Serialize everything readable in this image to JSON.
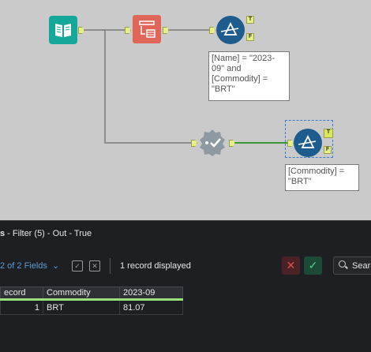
{
  "workflow": {
    "filter1": {
      "true_anchor": "T",
      "false_anchor": "F",
      "annotation": [
        "[Name] = \"2023-",
        "09\" and",
        "[Commodity] =",
        "\"BRT\""
      ]
    },
    "filter2": {
      "true_anchor": "T",
      "false_anchor": "F",
      "annotation": [
        "[Commodity] =",
        "\"BRT\""
      ]
    }
  },
  "results": {
    "title_prefix": "s",
    "title_rest": " - Filter (5) - Out - True",
    "fields_label": "2 of 2 Fields",
    "record_count": "1 record displayed",
    "search_label": "Sear",
    "columns": [
      "ecord",
      "Commodity",
      "2023-09"
    ],
    "rows": [
      {
        "record": "1",
        "commodity": "BRT",
        "value": "81.07"
      }
    ]
  },
  "colors": {
    "accent_green": "#9be07a",
    "filter_blue": "#1e5c8e",
    "formula_orange": "#e0665a",
    "input_teal": "#15a89a"
  }
}
